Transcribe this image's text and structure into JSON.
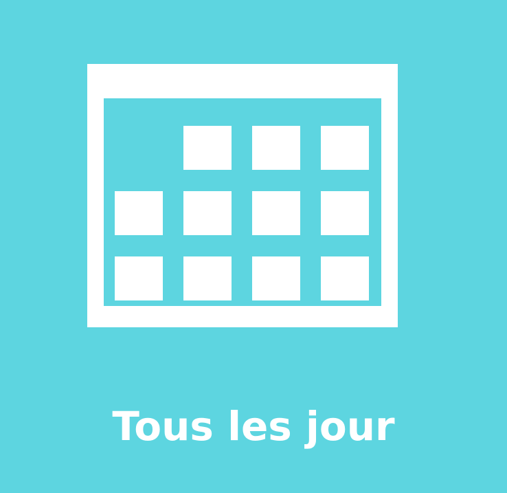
{
  "tile": {
    "background_color": "#5dd5e0",
    "icon": "calendar-icon",
    "icon_color": "#ffffff",
    "caption": "Tous les jour"
  }
}
